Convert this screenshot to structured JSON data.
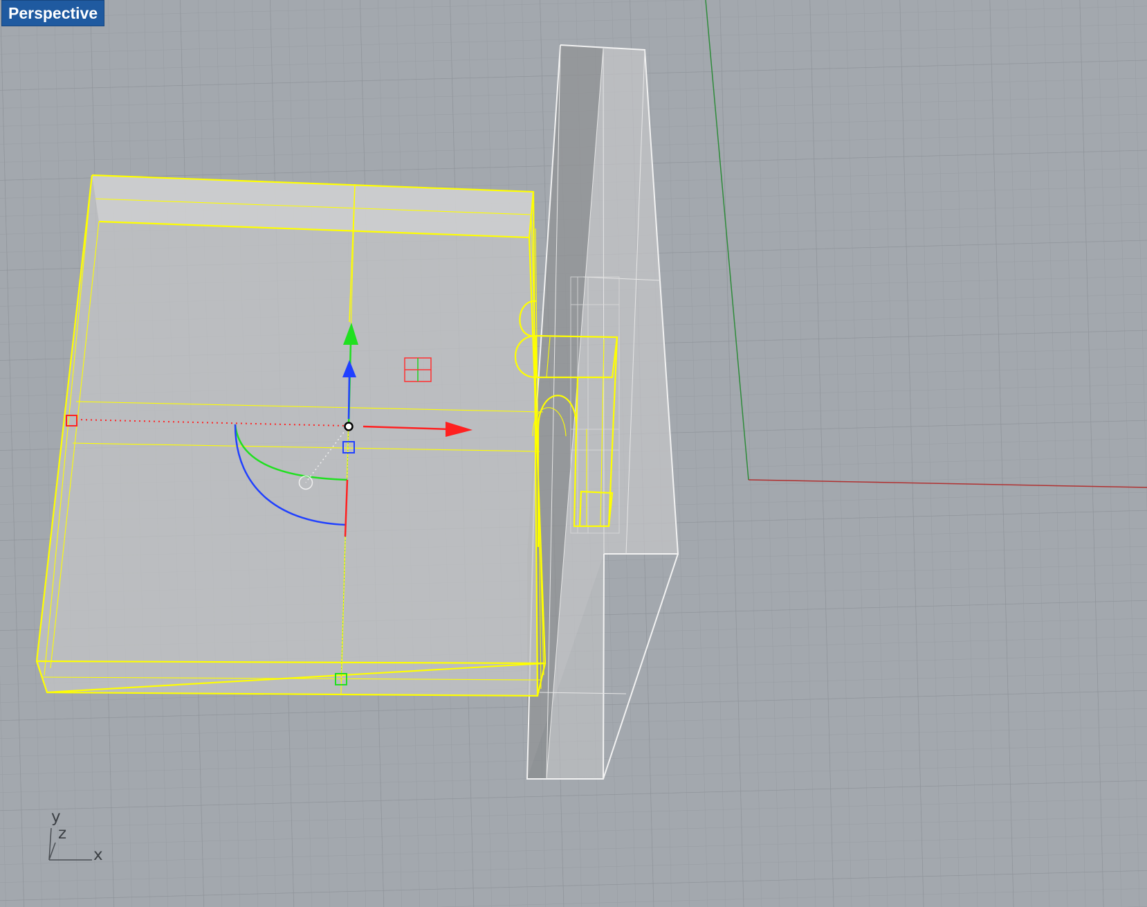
{
  "viewport": {
    "label": "Perspective",
    "background": "#a3a8ae",
    "grid_color": "#959aa0",
    "selection_color": "#ffff00",
    "world_x_axis_color": "#b03030",
    "world_y_axis_color": "#2e8b3a"
  },
  "axis_indicator": {
    "x_label": "x",
    "y_label": "y",
    "z_label": "z"
  },
  "gumball": {
    "x_color": "#ff2020",
    "y_color": "#20e020",
    "z_color": "#2040ff"
  }
}
